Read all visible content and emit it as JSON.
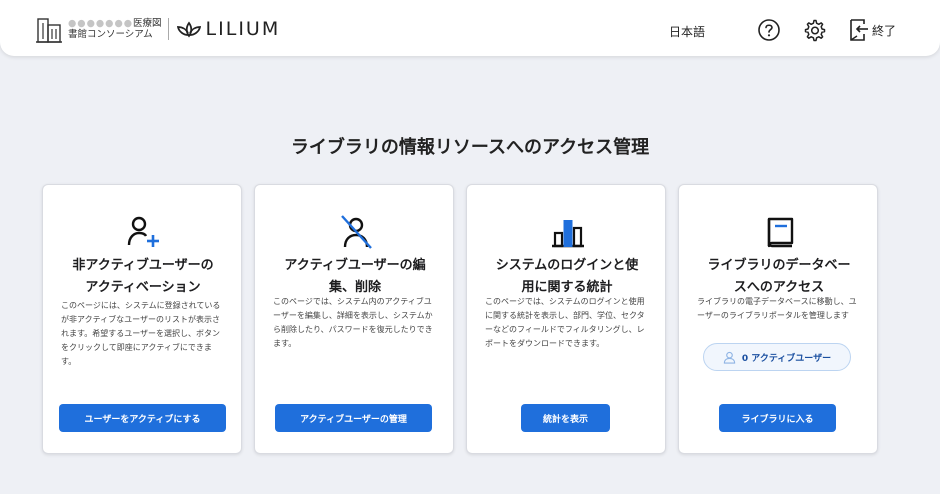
{
  "header": {
    "consortium_top_obscured": "●●●●●●●",
    "consortium_top": "医療図",
    "consortium_bottom": "書館コンソーシアム",
    "brand": "LILIUM",
    "language": "日本語",
    "exit_label": "終了",
    "icons": {
      "building": "building-icon",
      "lilium": "lilium-logo",
      "help": "help-icon",
      "settings": "gear-icon",
      "exit": "exit-icon"
    }
  },
  "page_title": "ライブラリの情報リソースへのアクセス管理",
  "cards": [
    {
      "icon": "user-plus-icon",
      "title_line1": "非アクティブユーザーの",
      "title_line2": "アクティベーション",
      "description": "このページには、システムに登録されているが非アクティブなユーザーのリストが表示されます。希望するユーザーを選択し、ボタンをクリックして即座にアクティブにできます。",
      "button": "ユーザーをアクティブにする"
    },
    {
      "icon": "user-slash-icon",
      "title_line1": "アクティブユーザーの編",
      "title_line2": "集、削除",
      "description": "このページでは、システム内のアクティブユーザーを編集し、詳細を表示し、システムから削除したり、パスワードを復元したりできます。",
      "button": "アクティブユーザーの管理"
    },
    {
      "icon": "bar-chart-icon",
      "title_line1": "システムのログインと使",
      "title_line2": "用に関する統計",
      "description": "このページでは、システムのログインと使用に関する統計を表示し、部門、学位、セクターなどのフィールドでフィルタリングし、レポートをダウンロードできます。",
      "button": "統計を表示"
    },
    {
      "icon": "book-icon",
      "title_line1": "ライブラリのデータベー",
      "title_line2": "スへのアクセス",
      "description": "ライブラリの電子データベースに移動し、ユーザーのライブラリポータルを管理します",
      "active_users": "0 アクティブユーザー",
      "button": "ライブラリに入る"
    }
  ],
  "colors": {
    "accent": "#1f6fdc",
    "background": "#eef0f5",
    "card": "#ffffff"
  }
}
